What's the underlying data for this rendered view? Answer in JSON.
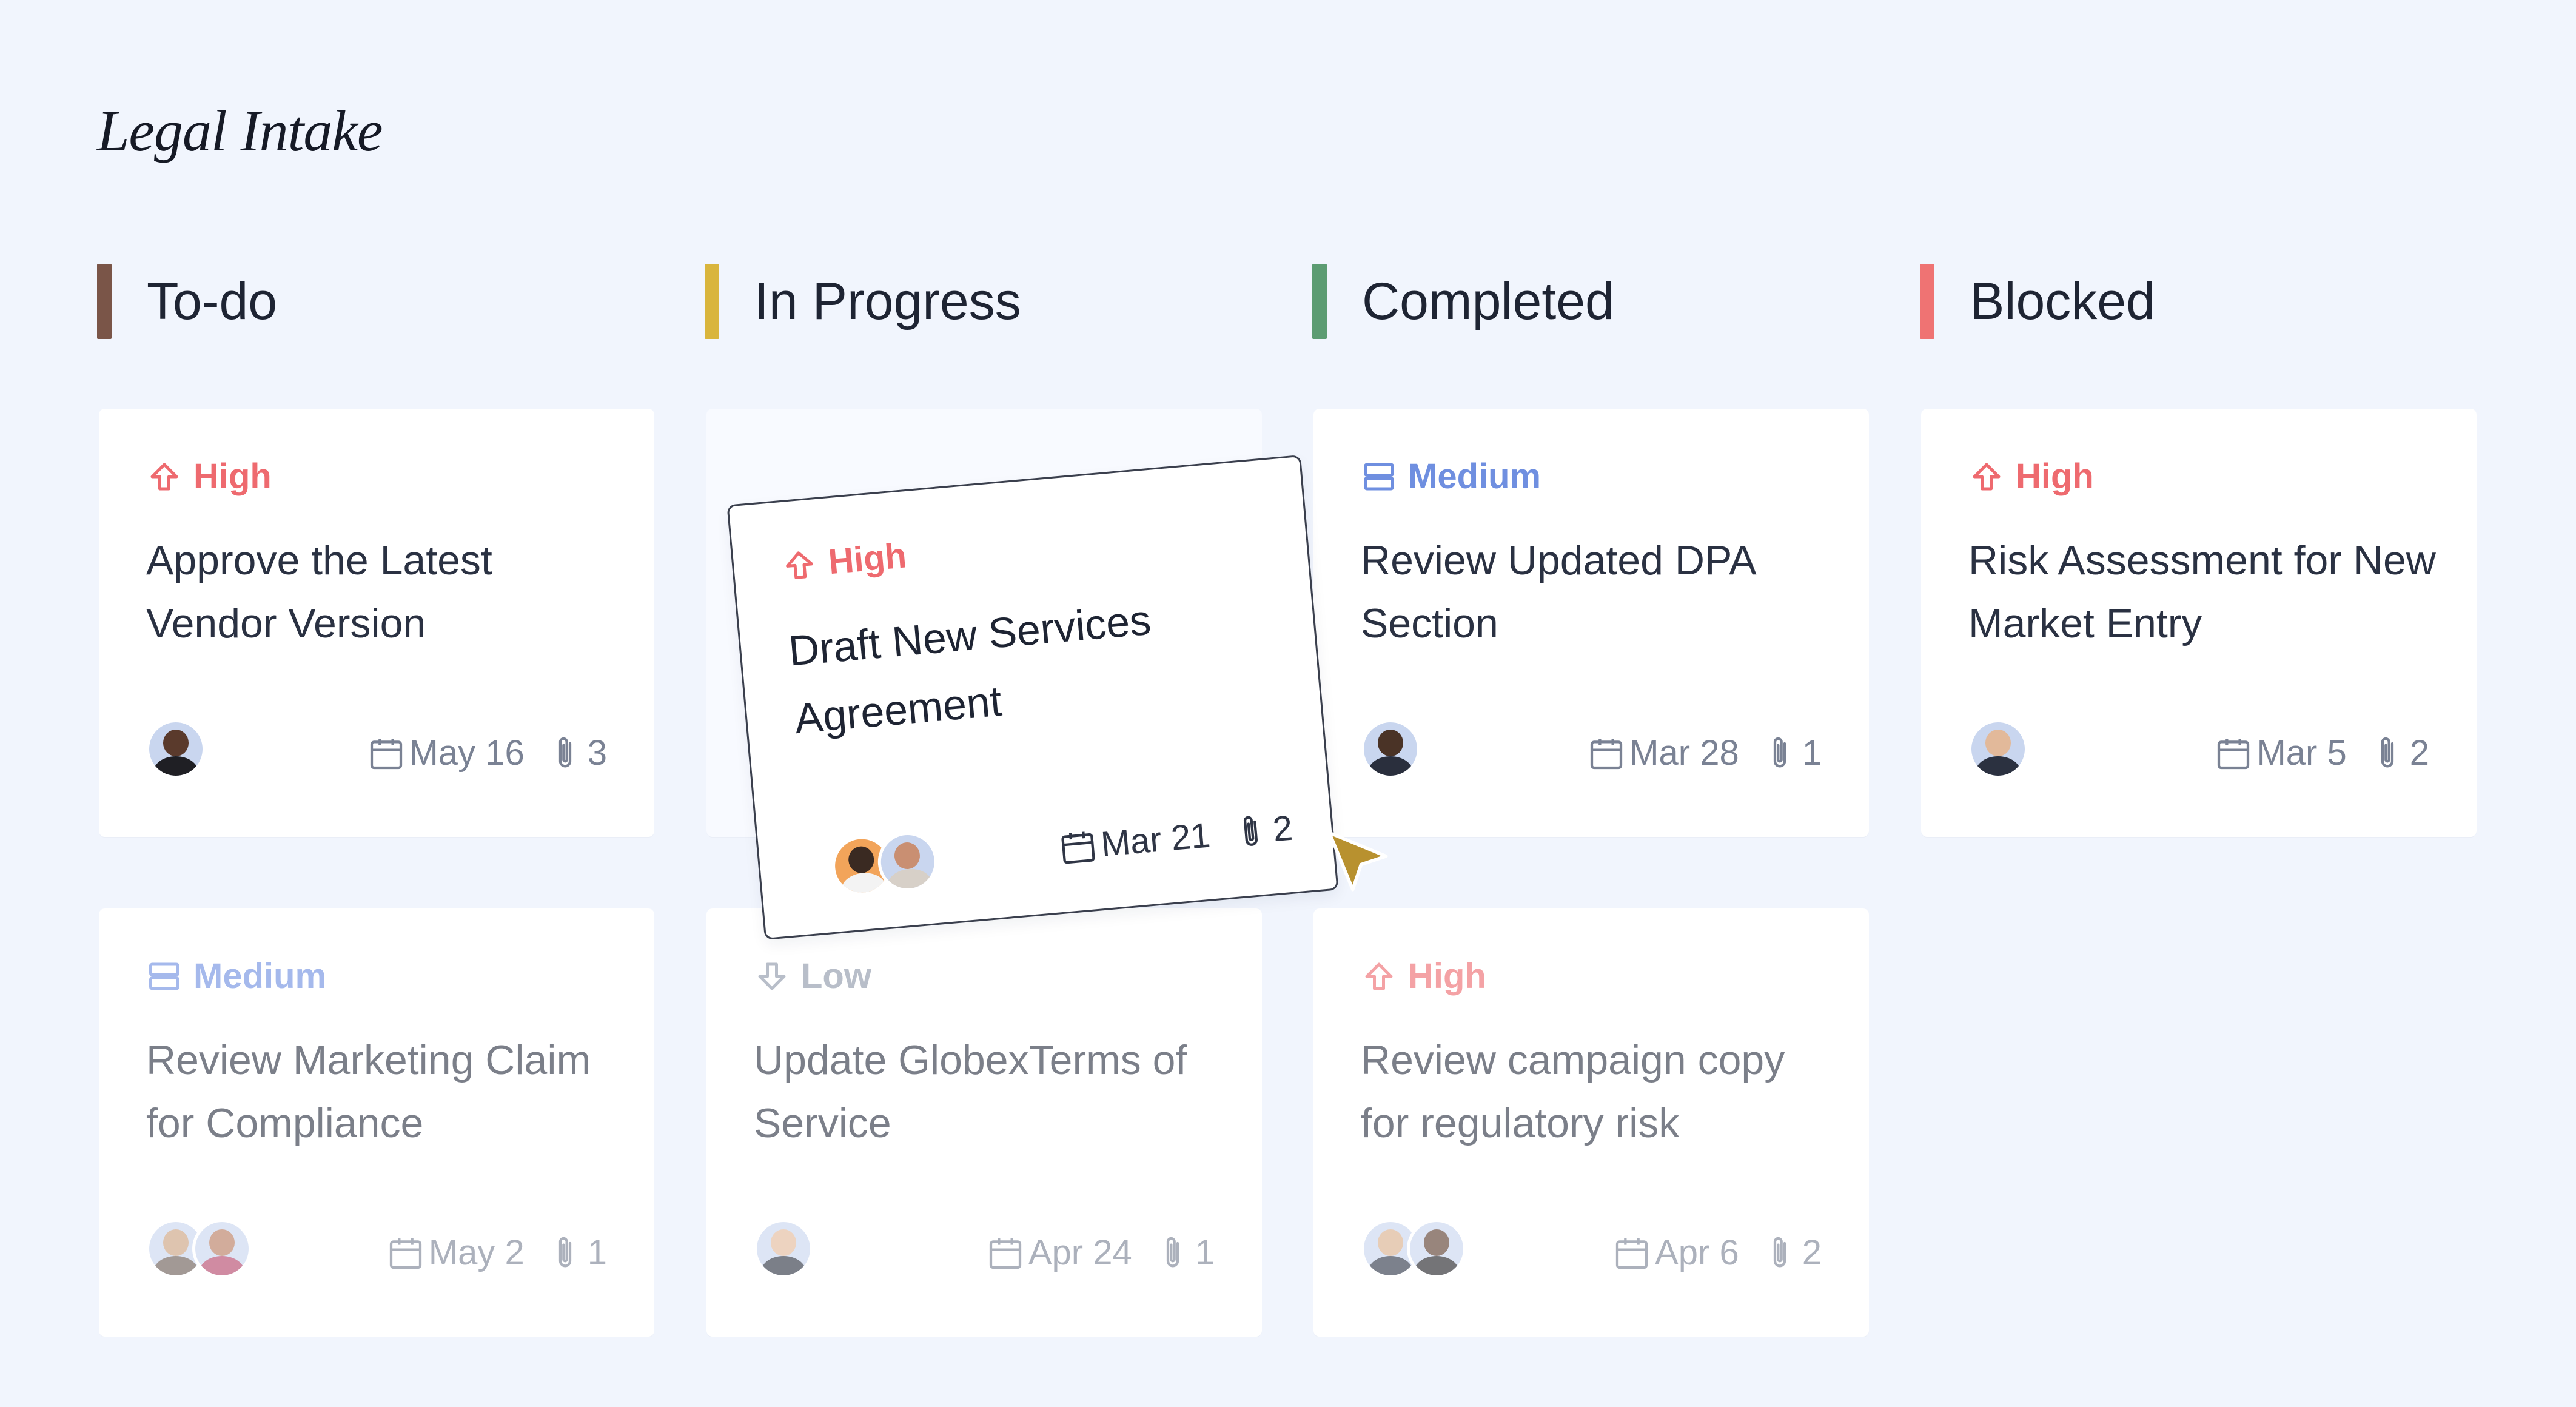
{
  "board": {
    "title": "Legal Intake"
  },
  "colors": {
    "high": "#ee6a6f",
    "medium": "#6f8fe0",
    "low": "#8d97a8",
    "todo_bar": "#7a5548",
    "progress_bar": "#d9b53d",
    "completed_bar": "#5c9c72",
    "blocked_bar": "#ef7373",
    "cursor": "#b8912f"
  },
  "columns": [
    {
      "label": "To-do"
    },
    {
      "label": "In Progress"
    },
    {
      "label": "Completed"
    },
    {
      "label": "Blocked"
    }
  ],
  "cards": [
    {
      "priority": "High",
      "priority_icon": "arrow-up-icon",
      "title": "Approve the Latest Vendor Version",
      "date": "May 16",
      "attachments": "3",
      "assignees": [
        "avatar-woman-dark"
      ]
    },
    {
      "priority": "Medium",
      "priority_icon": "medium-priority-icon",
      "title": "Review Updated DPA Section",
      "date": "Mar 28",
      "attachments": "1",
      "assignees": [
        "avatar-man-dark"
      ]
    },
    {
      "priority": "High",
      "priority_icon": "arrow-up-icon",
      "title": "Risk Assessment for New Market Entry",
      "date": "Mar 5",
      "attachments": "2",
      "assignees": [
        "avatar-man-glasses"
      ]
    },
    {
      "priority": "Medium",
      "priority_icon": "medium-priority-icon",
      "title": "Review Marketing Claim for Compliance",
      "date": "May 2",
      "attachments": "1",
      "assignees": [
        "avatar-woman-1",
        "avatar-woman-2"
      ]
    },
    {
      "priority": "Low",
      "priority_icon": "arrow-down-icon",
      "title": "Update GlobexTerms of Service",
      "date": "Apr 24",
      "attachments": "1",
      "assignees": [
        "avatar-man-glasses"
      ]
    },
    {
      "priority": "High",
      "priority_icon": "arrow-up-icon",
      "title": "Review campaign copy for regulatory risk",
      "date": "Apr 6",
      "attachments": "2",
      "assignees": [
        "avatar-man-suit",
        "avatar-woman-dark"
      ]
    }
  ],
  "dragging_card": {
    "priority": "High",
    "priority_icon": "arrow-up-icon",
    "title": "Draft New Services Agreement",
    "date": "Mar 21",
    "attachments": "2",
    "assignees": [
      "avatar-man-curly",
      "avatar-woman-3"
    ]
  }
}
